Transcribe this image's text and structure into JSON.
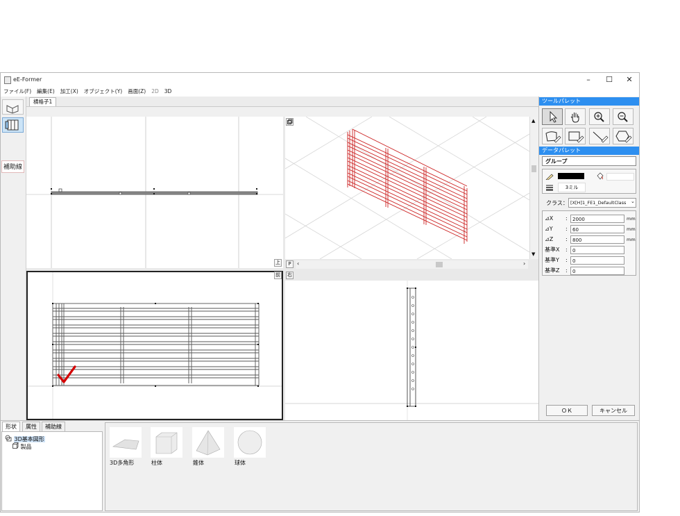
{
  "window": {
    "title": "eE-Former"
  },
  "window_controls": {
    "minimize": "–",
    "maximize": "☐",
    "close": "✕"
  },
  "menu": [
    "ファイル(F)",
    "編集(E)",
    "加工(X)",
    "オブジェクト(Y)",
    "画面(Z)",
    "2D",
    "3D"
  ],
  "left_strip": {
    "hojo_label": "補助線"
  },
  "document_tab": "横格子1",
  "view_buttons": {
    "top": "上",
    "persp": "P",
    "front": "前",
    "right": "右"
  },
  "tool_palette": {
    "title": "ツールパレット"
  },
  "data_palette": {
    "title": "データパレット",
    "group_label": "グループ",
    "line_width": "3ミル",
    "class_label": "クラス：",
    "class_value": "[X[H]1_FE1_DefaultClass",
    "fields": [
      {
        "label": "⊿X",
        "value": "2000",
        "unit": "mm"
      },
      {
        "label": "⊿Y",
        "value": "60",
        "unit": "mm"
      },
      {
        "label": "⊿Z",
        "value": "800",
        "unit": "mm"
      },
      {
        "label": "基準X",
        "value": "0",
        "unit": ""
      },
      {
        "label": "基準Y",
        "value": "0",
        "unit": ""
      },
      {
        "label": "基準Z",
        "value": "0",
        "unit": ""
      }
    ]
  },
  "buttons": {
    "ok": "ＯＫ",
    "cancel": "キャンセル"
  },
  "bottom_tabs": [
    "形状",
    "属性",
    "補助線"
  ],
  "tree": {
    "items": [
      "3D基本図形",
      "製品"
    ]
  },
  "shapes": [
    "3D多角形",
    "柱体",
    "錐体",
    "球体"
  ],
  "colors": {
    "accent": "#2d8ff0",
    "model_red": "#cc2222",
    "check_red": "#d40000"
  }
}
